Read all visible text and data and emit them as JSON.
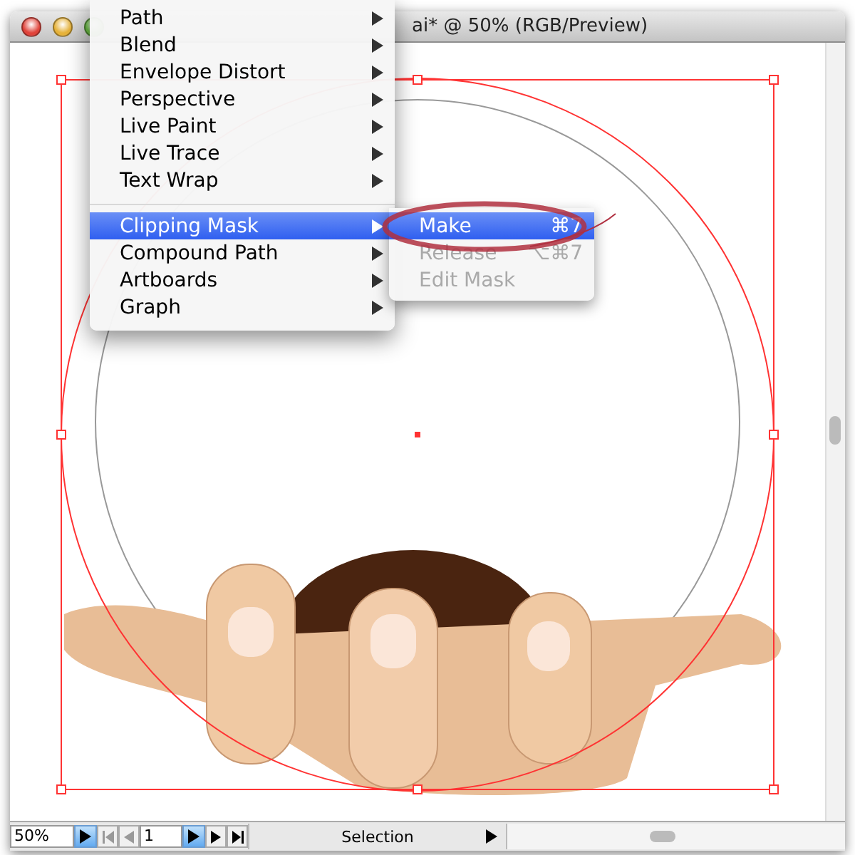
{
  "window": {
    "title": "ai* @ 50% (RGB/Preview)"
  },
  "menu": {
    "items": [
      {
        "kind": "item",
        "label": "Path",
        "selected": false
      },
      {
        "kind": "item",
        "label": "Blend",
        "selected": false
      },
      {
        "kind": "item",
        "label": "Envelope Distort",
        "selected": false
      },
      {
        "kind": "item",
        "label": "Perspective",
        "selected": false
      },
      {
        "kind": "item",
        "label": "Live Paint",
        "selected": false
      },
      {
        "kind": "item",
        "label": "Live Trace",
        "selected": false
      },
      {
        "kind": "item",
        "label": "Text Wrap",
        "selected": false
      },
      {
        "kind": "separator"
      },
      {
        "kind": "item",
        "label": "Clipping Mask",
        "selected": true
      },
      {
        "kind": "item",
        "label": "Compound Path",
        "selected": false
      },
      {
        "kind": "item",
        "label": "Artboards",
        "selected": false
      },
      {
        "kind": "item",
        "label": "Graph",
        "selected": false
      }
    ]
  },
  "submenu": {
    "items": [
      {
        "label": "Make",
        "shortcut": "⌘7",
        "selected": true,
        "disabled": false
      },
      {
        "label": "Release",
        "shortcut": "⌥⌘7",
        "selected": false,
        "disabled": true
      },
      {
        "label": "Edit Mask",
        "selected": false,
        "disabled": true
      }
    ]
  },
  "status_bar": {
    "zoom": "50%",
    "page": "1",
    "tool": "Selection"
  }
}
